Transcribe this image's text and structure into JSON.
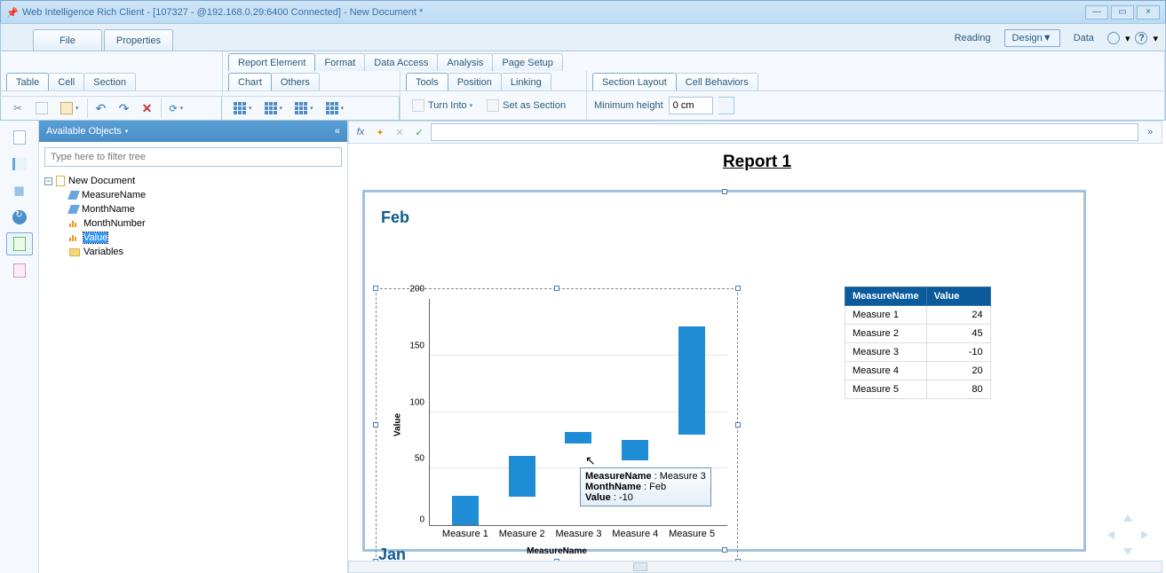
{
  "window": {
    "title": "Web Intelligence Rich Client - [107327 - @192.168.0.29:6400 Connected]  - New Document *",
    "minimize": "—",
    "maximize": "▭",
    "close": "×"
  },
  "app_tabs": {
    "file": "File",
    "properties": "Properties"
  },
  "right_controls": {
    "reading": "Reading",
    "design": "Design",
    "data": "Data"
  },
  "ribbon_a": {
    "report_element": "Report Element",
    "format": "Format",
    "data_access": "Data Access",
    "analysis": "Analysis",
    "page_setup": "Page Setup"
  },
  "ribbon_b": {
    "cluster1": {
      "table": "Table",
      "cell": "Cell",
      "section": "Section"
    },
    "cluster2": {
      "chart": "Chart",
      "others": "Others"
    },
    "cluster3": {
      "tools": "Tools",
      "position": "Position",
      "linking": "Linking"
    },
    "cluster4": {
      "section_layout": "Section Layout",
      "cell_behaviors": "Cell Behaviors"
    }
  },
  "tool_c": {
    "turn_into": "Turn Into",
    "set_as_section": "Set as Section",
    "min_height_label": "Minimum height",
    "min_height_value": "0 cm"
  },
  "sidepanel": {
    "title": "Available Objects",
    "filter_placeholder": "Type here to filter tree",
    "root": "New Document",
    "items": [
      "MeasureName",
      "MonthName",
      "MonthNumber",
      "Value",
      "Variables"
    ]
  },
  "report": {
    "title": "Report 1",
    "section1": "Feb",
    "section2": "Jan"
  },
  "chart_data": {
    "type": "bar",
    "title": "",
    "xlabel": "MeasureName",
    "ylabel": "Value",
    "ylim": [
      0,
      200
    ],
    "yticks": [
      0,
      50,
      100,
      150,
      200
    ],
    "categories": [
      "Measure 1",
      "Measure 2",
      "Measure 3",
      "Measure 4",
      "Measure 5"
    ],
    "values": [
      24,
      45,
      -10,
      20,
      80
    ],
    "note": "Bars visually drawn from ~0 to 200; Measure 5 bar extends well above tick 150"
  },
  "tooltip": {
    "l1k": "MeasureName",
    "l1v": "Measure 3",
    "l2k": "MonthName",
    "l2v": "Feb",
    "l3k": "Value",
    "l3v": "-10"
  },
  "table": {
    "headers": [
      "MeasureName",
      "Value"
    ],
    "rows": [
      [
        "Measure 1",
        "24"
      ],
      [
        "Measure 2",
        "45"
      ],
      [
        "Measure 3",
        "-10"
      ],
      [
        "Measure 4",
        "20"
      ],
      [
        "Measure 5",
        "80"
      ]
    ]
  }
}
